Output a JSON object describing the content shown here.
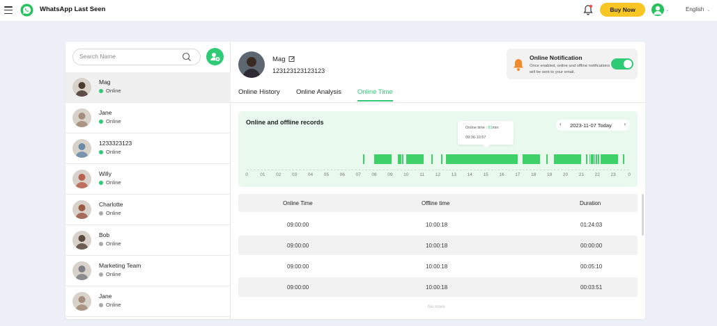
{
  "app": {
    "title": "WhatsApp Last Seen"
  },
  "header": {
    "buy_label": "Buy Now",
    "language": "English",
    "accent": "#f7c624"
  },
  "search": {
    "placeholder": "Search Name"
  },
  "contacts": [
    {
      "name": "Mag",
      "status": "Online",
      "status_color": "#2fca75",
      "avatar_bg": "#4a3a30"
    },
    {
      "name": "Jane",
      "status": "Online",
      "status_color": "#2fca75",
      "avatar_bg": "#a38c7a"
    },
    {
      "name": "1233323123",
      "status": "Online",
      "status_color": "#2fca75",
      "avatar_bg": "#6b8aa8"
    },
    {
      "name": "Willy",
      "status": "Online",
      "status_color": "#2fca75",
      "avatar_bg": "#b9614f"
    },
    {
      "name": "Charlotte",
      "status": "Online",
      "status_color": "#a8a8a8",
      "avatar_bg": "#9b5a45"
    },
    {
      "name": "Bob",
      "status": "Online",
      "status_color": "#a8a8a8",
      "avatar_bg": "#5c4a3f"
    },
    {
      "name": "Marketing Team",
      "status": "Online",
      "status_color": "#a8a8a8",
      "avatar_bg": "#7f7f85"
    },
    {
      "name": "Jane",
      "status": "Online",
      "status_color": "#a8a8a8",
      "avatar_bg": "#a38c7a"
    }
  ],
  "profile": {
    "name": "Mag",
    "number": "123123123123123"
  },
  "notification": {
    "title": "Online Notification",
    "description": "Once enabled, online and offline notifications will be sent to your email.",
    "enabled": true
  },
  "tabs": [
    {
      "label": "Online History"
    },
    {
      "label": "Online Analysis"
    },
    {
      "label": "Online Time",
      "active": true
    }
  ],
  "records": {
    "title": "Online and offline records",
    "date": "2023-11-07 Today",
    "tooltip": {
      "label": "Online time : ",
      "value": "81",
      "unit": "min",
      "range": "09:36-10:57"
    },
    "hours": [
      "0",
      "01",
      "02",
      "03",
      "04",
      "05",
      "06",
      "07",
      "08",
      "09",
      "10",
      "11",
      "12",
      "13",
      "14",
      "15",
      "16",
      "17",
      "18",
      "19",
      "20",
      "21",
      "22",
      "23",
      "0"
    ],
    "online_segments": [
      [
        7.3,
        7.4
      ],
      [
        8.0,
        9.1
      ],
      [
        9.5,
        9.7
      ],
      [
        9.75,
        9.85
      ],
      [
        10.0,
        11.1
      ],
      [
        11.6,
        11.68
      ],
      [
        12.2,
        12.3
      ],
      [
        12.5,
        17.0
      ],
      [
        17.3,
        18.4
      ],
      [
        18.8,
        18.88
      ],
      [
        19.3,
        21.0
      ],
      [
        21.3,
        21.38
      ],
      [
        21.5,
        21.55
      ],
      [
        21.6,
        21.65
      ],
      [
        21.7,
        21.75
      ],
      [
        21.8,
        21.85
      ],
      [
        21.9,
        22.0
      ],
      [
        22.05,
        22.1
      ],
      [
        22.2,
        23.3
      ],
      [
        23.6,
        23.7
      ]
    ]
  },
  "table": {
    "headers": [
      "Online Time",
      "Offline time",
      "Duration"
    ],
    "rows": [
      [
        "09:00:00",
        "10:00:18",
        "01:24:03"
      ],
      [
        "09:00:00",
        "10:00:18",
        "00:00:00"
      ],
      [
        "09:00:00",
        "10:00:18",
        "00:05:10"
      ],
      [
        "09:00:00",
        "10:00:18",
        "00:03:51"
      ]
    ],
    "footer": "No more"
  },
  "colors": {
    "accent": "#2fca75",
    "bar": "#3ed069",
    "panel": "#e9f9ee"
  },
  "icons": [
    "menu-icon",
    "whatsapp-logo-icon",
    "bell-icon",
    "search-icon",
    "add-contact-icon",
    "edit-icon",
    "notification-bell-icon",
    "chevron-left-icon",
    "chevron-right-icon"
  ]
}
